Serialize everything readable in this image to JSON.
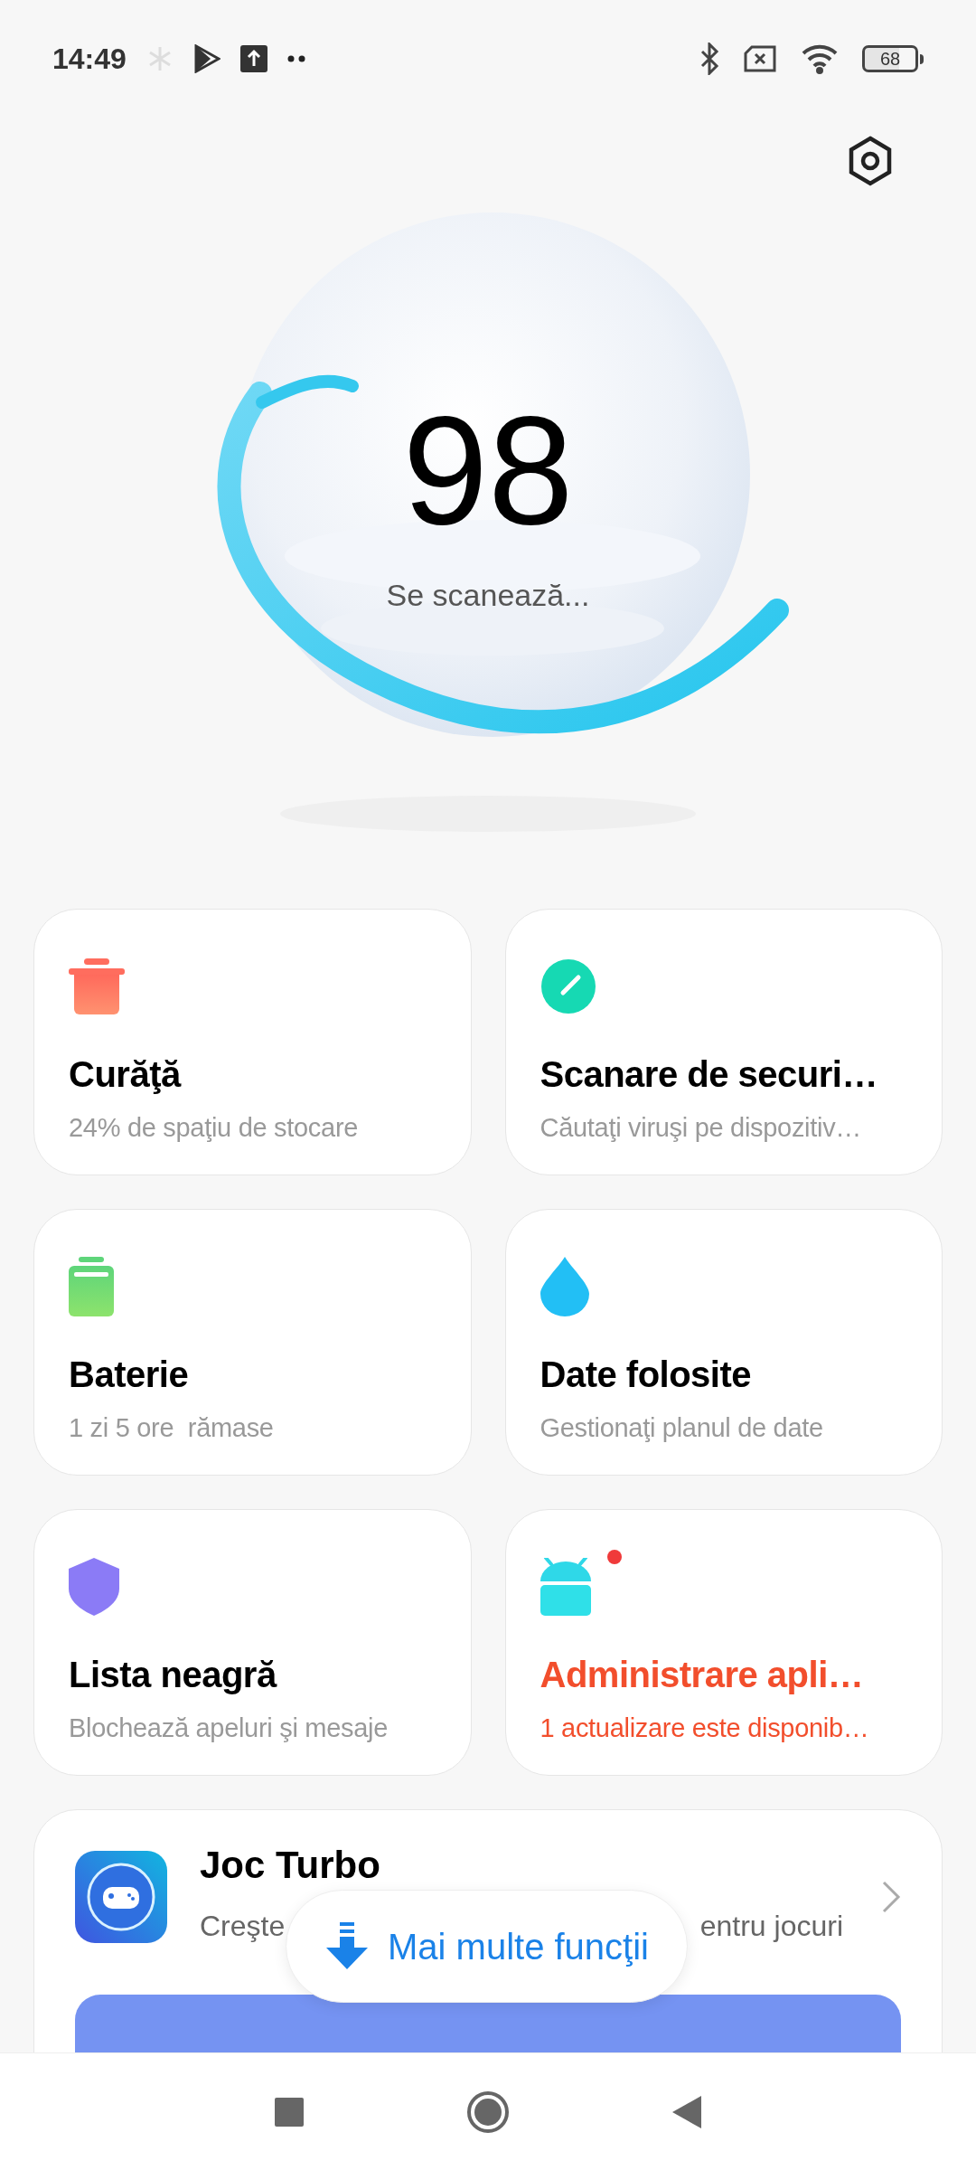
{
  "status_bar": {
    "time": "14:49",
    "battery": "68"
  },
  "score": {
    "value": "98",
    "caption": "Se scanează..."
  },
  "cards": [
    {
      "kind": "trash",
      "title": "Curăţă",
      "subtitle": "24% de spaţiu de stocare",
      "alert": false
    },
    {
      "kind": "gauge",
      "title": "Scanare de securi…",
      "subtitle": "Căutaţi viruşi pe dispozitiv…",
      "alert": false
    },
    {
      "kind": "battery",
      "title": "Baterie",
      "subtitle": "1 zi 5 ore  rămase",
      "alert": false
    },
    {
      "kind": "drop",
      "title": "Date folosite",
      "subtitle": "Gestionaţi planul de date",
      "alert": false
    },
    {
      "kind": "shield",
      "title": "Lista neagră",
      "subtitle": "Blochează apeluri şi mesaje",
      "alert": false
    },
    {
      "kind": "android",
      "title": "Administrare apli…",
      "subtitle": "1 actualizare este disponib…",
      "alert": true
    }
  ],
  "feature": {
    "title": "Joc Turbo",
    "subtitle": [
      "Creşte",
      "entru jocuri"
    ]
  },
  "more_button": {
    "label": "Mai multe funcţii"
  }
}
